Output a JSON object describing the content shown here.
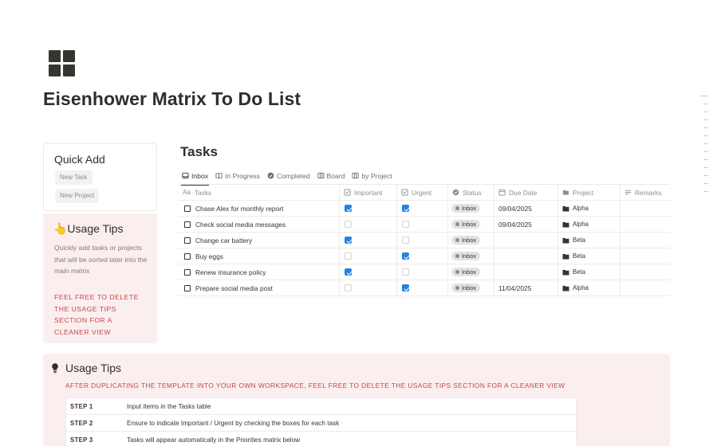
{
  "page": {
    "icon": "grid-icon",
    "title": "Eisenhower Matrix To Do List"
  },
  "quick_add": {
    "title": "Quick Add",
    "buttons": [
      "New Task",
      "New Project"
    ]
  },
  "side_tips": {
    "title": "👆Usage Tips",
    "description": "Quickly add tasks or projects that will be sorted later into the main matrix",
    "warning": "FEEL FREE TO DELETE THE USAGE TIPS SECTION FOR A CLEANER VIEW"
  },
  "tasks": {
    "title": "Tasks",
    "tabs": [
      {
        "label": "Inbox",
        "icon": "inbox-icon",
        "active": true
      },
      {
        "label": "In Progress",
        "icon": "book-icon",
        "active": false
      },
      {
        "label": "Completed",
        "icon": "check-circle-icon",
        "active": false
      },
      {
        "label": "Board",
        "icon": "board-icon",
        "active": false
      },
      {
        "label": "by Project",
        "icon": "board-icon",
        "active": false
      }
    ],
    "columns": {
      "task": "Tasks",
      "task_prefix": "Aa",
      "important": "Important",
      "urgent": "Urgent",
      "status": "Status",
      "due": "Due Date",
      "project": "Project",
      "remarks": "Remarks"
    },
    "rows": [
      {
        "task": "Chase Alex for monthly report",
        "important": true,
        "urgent": true,
        "status": "Inbox",
        "due": "09/04/2025",
        "project": "Alpha"
      },
      {
        "task": "Check social media messages",
        "important": false,
        "urgent": false,
        "status": "Inbox",
        "due": "09/04/2025",
        "project": "Alpha"
      },
      {
        "task": "Change car battery",
        "important": true,
        "urgent": false,
        "status": "Inbox",
        "due": "",
        "project": "Beta"
      },
      {
        "task": "Buy eggs",
        "important": false,
        "urgent": true,
        "status": "Inbox",
        "due": "",
        "project": "Beta"
      },
      {
        "task": "Renew insurance policy",
        "important": true,
        "urgent": false,
        "status": "Inbox",
        "due": "",
        "project": "Beta"
      },
      {
        "task": "Prepare social media post",
        "important": false,
        "urgent": true,
        "status": "Inbox",
        "due": "11/04/2025",
        "project": "Alpha"
      }
    ]
  },
  "bottom_tips": {
    "title": "Usage Tips",
    "warning": "AFTER DUPLICATING THE TEMPLATE INTO YOUR OWN WORKSPACE, FEEL FREE TO DELETE THE USAGE TIPS SECTION FOR A CLEANER VIEW",
    "steps": [
      {
        "label": "STEP 1",
        "text": "Input items in the Tasks table"
      },
      {
        "label": "STEP 2",
        "text": "Ensure to indicate Important / Urgent by checking the boxes for each task"
      },
      {
        "label": "STEP 3",
        "text": "Tasks will appear automatically in the Priorities matrix below"
      }
    ]
  },
  "colors": {
    "accent_blue": "#2383e2",
    "tips_background": "#fbeeef",
    "warning_red": "#c0494b"
  }
}
